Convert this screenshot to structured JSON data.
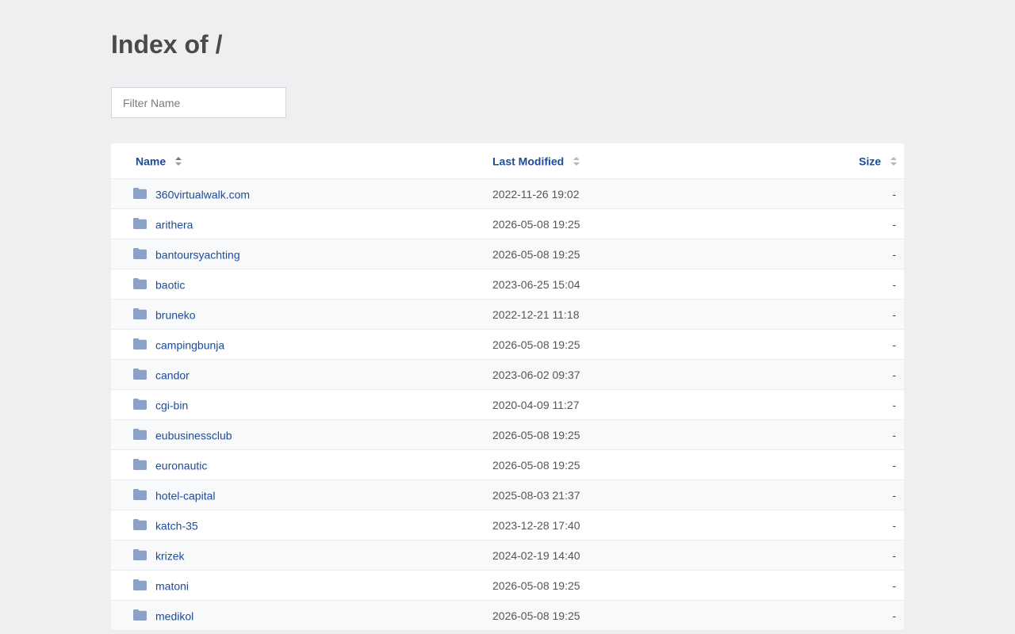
{
  "page": {
    "title": "Index of /"
  },
  "filter": {
    "placeholder": "Filter Name",
    "value": ""
  },
  "table": {
    "headers": {
      "name": "Name",
      "modified": "Last Modified",
      "size": "Size"
    },
    "rows": [
      {
        "name": "360virtualwalk.com",
        "modified": "2022-11-26 19:02",
        "size": "-"
      },
      {
        "name": "arithera",
        "modified": "2026-05-08 19:25",
        "size": "-"
      },
      {
        "name": "bantoursyachting",
        "modified": "2026-05-08 19:25",
        "size": "-"
      },
      {
        "name": "baotic",
        "modified": "2023-06-25 15:04",
        "size": "-"
      },
      {
        "name": "bruneko",
        "modified": "2022-12-21 11:18",
        "size": "-"
      },
      {
        "name": "campingbunja",
        "modified": "2026-05-08 19:25",
        "size": "-"
      },
      {
        "name": "candor",
        "modified": "2023-06-02 09:37",
        "size": "-"
      },
      {
        "name": "cgi-bin",
        "modified": "2020-04-09 11:27",
        "size": "-"
      },
      {
        "name": "eubusinessclub",
        "modified": "2026-05-08 19:25",
        "size": "-"
      },
      {
        "name": "euronautic",
        "modified": "2026-05-08 19:25",
        "size": "-"
      },
      {
        "name": "hotel-capital",
        "modified": "2025-08-03 21:37",
        "size": "-"
      },
      {
        "name": "katch-35",
        "modified": "2023-12-28 17:40",
        "size": "-"
      },
      {
        "name": "krizek",
        "modified": "2024-02-19 14:40",
        "size": "-"
      },
      {
        "name": "matoni",
        "modified": "2026-05-08 19:25",
        "size": "-"
      },
      {
        "name": "medikol",
        "modified": "2026-05-08 19:25",
        "size": "-"
      }
    ]
  },
  "icons": {
    "row_icon": "folder-icon",
    "sort_icon": "sort-arrows-icon"
  },
  "colors": {
    "link": "#1a4c9c",
    "folder": "#8ca1c6",
    "background": "#eeeff1"
  }
}
